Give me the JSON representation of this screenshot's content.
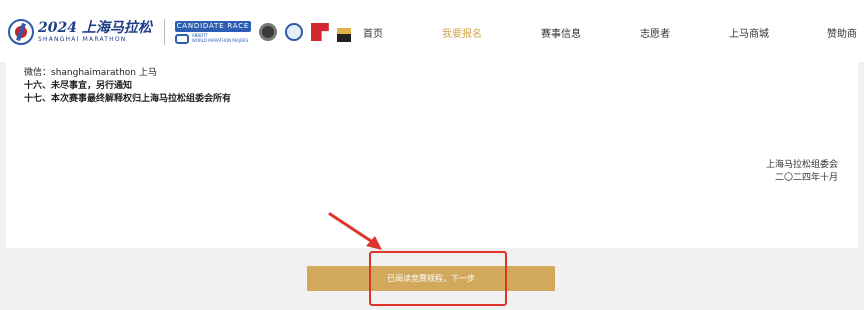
{
  "header": {
    "logo": {
      "main": "2024 上海马拉松",
      "sub": "SHANGHAI MARATHON"
    },
    "candidate": {
      "top": "CANDIDATE RACE",
      "small_1": "ABBOTT",
      "small_2": "WORLD MARATHON MAJORS"
    },
    "nav": [
      {
        "label": "首页",
        "active": false
      },
      {
        "label": "我要报名",
        "active": true
      },
      {
        "label": "赛事信息",
        "active": false
      },
      {
        "label": "志愿者",
        "active": false
      },
      {
        "label": "上马商城",
        "active": false
      },
      {
        "label": "赞助商",
        "active": false
      }
    ]
  },
  "content": {
    "lines": [
      "微信：shanghaimarathon 上马",
      "十六、未尽事宜，另行通知",
      "十七、本次赛事最终解释权归上海马拉松组委会所有"
    ],
    "signature": {
      "org": "上海马拉松组委会",
      "date": "二〇二四年十月"
    }
  },
  "actions": {
    "next_label": "已阅读竞赛规程，下一步"
  },
  "colors": {
    "accent": "#d2a95c",
    "nav_active": "#d1a650",
    "annotation": "#e0342a"
  }
}
